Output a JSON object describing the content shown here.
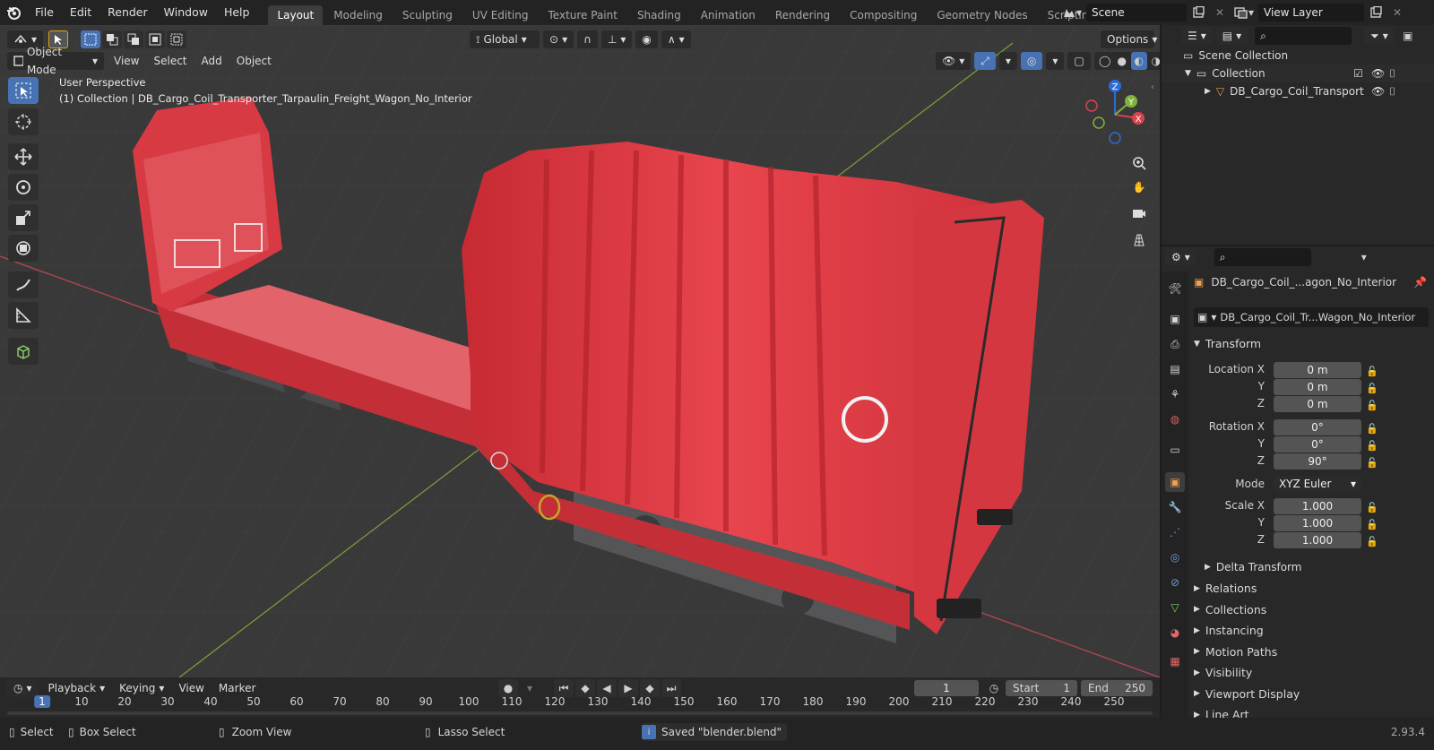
{
  "topbar": {
    "menus": [
      "File",
      "Edit",
      "Render",
      "Window",
      "Help"
    ],
    "workspaces": [
      "Layout",
      "Modeling",
      "Sculpting",
      "UV Editing",
      "Texture Paint",
      "Shading",
      "Animation",
      "Rendering",
      "Compositing",
      "Geometry Nodes",
      "Scripting"
    ],
    "active_workspace": "Layout",
    "scene": "Scene",
    "view_layer": "View Layer"
  },
  "viewport": {
    "mode": "Object Mode",
    "menus": [
      "View",
      "Select",
      "Add",
      "Object"
    ],
    "orientation": "Global",
    "options_label": "Options",
    "perspective_text": "User Perspective",
    "collection_text": "(1) Collection | DB_Cargo_Coil_Transporter_Tarpaulin_Freight_Wagon_No_Interior",
    "gizmo": {
      "x": "X",
      "y": "Y",
      "z": "Z"
    }
  },
  "outliner": {
    "scene_collection": "Scene Collection",
    "collection": "Collection",
    "object": "DB_Cargo_Coil_Transport"
  },
  "properties": {
    "object_name": "DB_Cargo_Coil_...agon_No_Interior",
    "data_name": "DB_Cargo_Coil_Tr...Wagon_No_Interior",
    "transform_header": "Transform",
    "location_x_label": "Location X",
    "y_label": "Y",
    "z_label": "Z",
    "rotation_x_label": "Rotation X",
    "scale_x_label": "Scale X",
    "mode_label": "Mode",
    "location": [
      "0 m",
      "0 m",
      "0 m"
    ],
    "rotation": [
      "0°",
      "0°",
      "90°"
    ],
    "mode": "XYZ Euler",
    "scale": [
      "1.000",
      "1.000",
      "1.000"
    ],
    "delta_transform": "Delta Transform",
    "sections": [
      "Relations",
      "Collections",
      "Instancing",
      "Motion Paths",
      "Visibility",
      "Viewport Display",
      "Line Art"
    ]
  },
  "timeline": {
    "menus": [
      "Playback",
      "Keying",
      "View",
      "Marker"
    ],
    "current_frame": "1",
    "start_label": "Start",
    "start": "1",
    "end_label": "End",
    "end": "250",
    "ticks": [
      "1",
      "10",
      "20",
      "30",
      "40",
      "50",
      "60",
      "70",
      "80",
      "90",
      "100",
      "110",
      "120",
      "130",
      "140",
      "150",
      "160",
      "170",
      "180",
      "190",
      "200",
      "210",
      "220",
      "230",
      "240",
      "250"
    ]
  },
  "statusbar": {
    "select": "Select",
    "box_select": "Box Select",
    "zoom_view": "Zoom View",
    "lasso_select": "Lasso Select",
    "message": "Saved \"blender.blend\"",
    "version": "2.93.4"
  },
  "colors": {
    "accent": "#4772b3",
    "wagon_red": "#e0353f",
    "x_axis": "#d6454f",
    "y_axis": "#7fb33a",
    "z_axis": "#2e6cd6"
  }
}
